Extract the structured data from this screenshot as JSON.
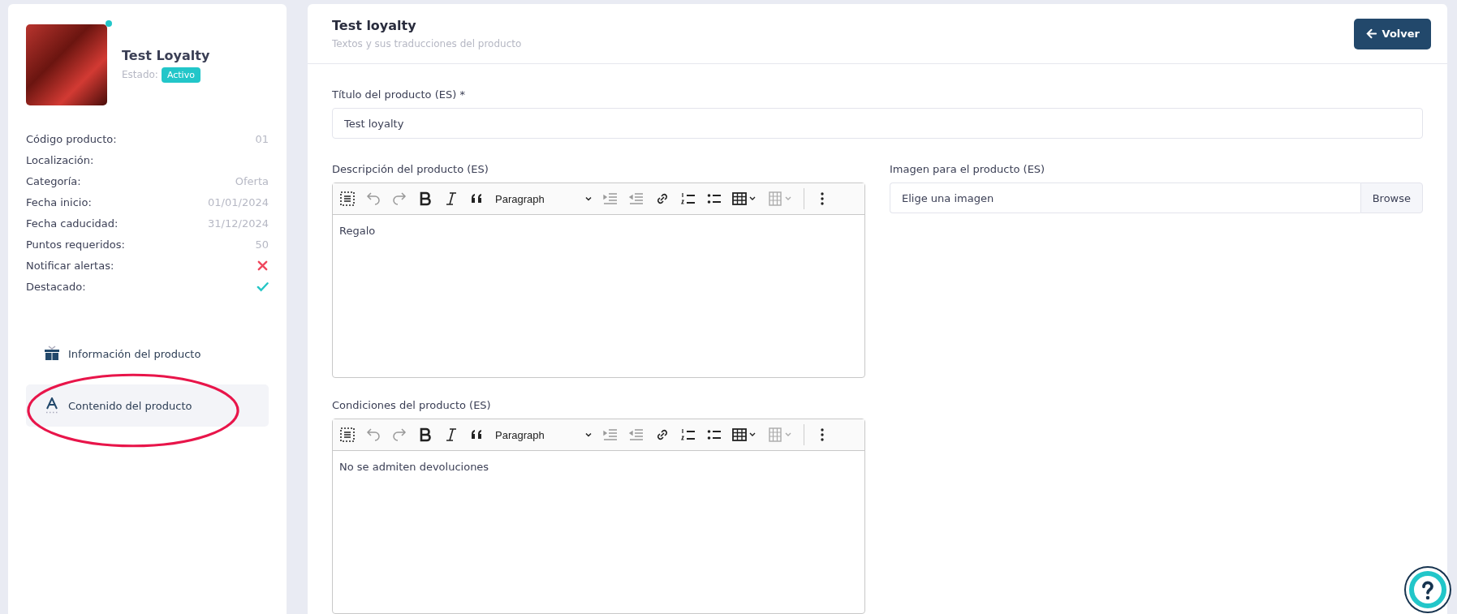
{
  "product": {
    "name": "Test Loyalty",
    "status_label": "Estado:",
    "status": "Activo",
    "online": true
  },
  "details": [
    {
      "label": "Código producto:",
      "kind": "text",
      "value": "01"
    },
    {
      "label": "Localización:",
      "kind": "text"
    },
    {
      "label": "Categoría:",
      "kind": "text",
      "value": "Oferta"
    },
    {
      "label": "Fecha inicio:",
      "kind": "text",
      "value": "01/01/2024"
    },
    {
      "label": "Fecha caducidad:",
      "kind": "text",
      "value": "31/12/2024"
    },
    {
      "label": "Puntos requeridos:",
      "kind": "text",
      "value": "50"
    },
    {
      "label": "Notificar alertas:",
      "kind": "bool",
      "on": false
    },
    {
      "label": "Destacado:",
      "kind": "bool",
      "on": true
    }
  ],
  "menu": [
    {
      "label": "Información del producto",
      "selected": false
    },
    {
      "label": "Contenido del producto",
      "selected": true
    }
  ],
  "header": {
    "title": "Test loyalty",
    "subtitle": "Textos y sus traducciones del producto",
    "back_button": "Volver"
  },
  "title_field": {
    "label": "Título del producto (ES) *",
    "value": "Test loyalty"
  },
  "description_editor": {
    "label": "Descripción del producto (ES)",
    "block_type": "Paragraph",
    "content": "Regalo"
  },
  "image_field": {
    "label": "Imagen para el producto (ES)",
    "placeholder": "Elige una imagen",
    "button": "Browse"
  },
  "conditions_editor": {
    "label": "Condiciones del producto (ES)",
    "block_type": "Paragraph",
    "content": "No se admiten devoluciones"
  }
}
